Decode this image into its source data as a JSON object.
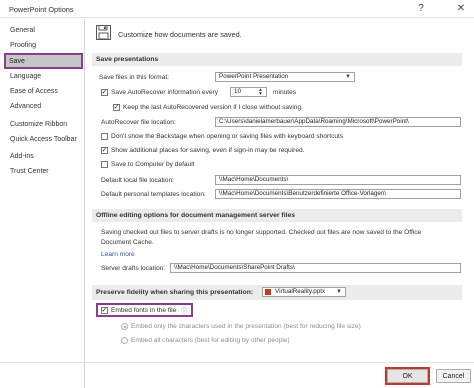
{
  "window": {
    "title": "PowerPoint Options",
    "help_icon": "?",
    "close_icon": "✕"
  },
  "sidebar": {
    "items": [
      {
        "label": "General"
      },
      {
        "label": "Proofing"
      },
      {
        "label": "Save"
      },
      {
        "label": "Language"
      },
      {
        "label": "Ease of Access"
      },
      {
        "label": "Advanced"
      },
      {
        "label": "Customize Ribbon"
      },
      {
        "label": "Quick Access Toolbar"
      },
      {
        "label": "Add-ins"
      },
      {
        "label": "Trust Center"
      }
    ]
  },
  "header": {
    "text": "Customize how documents are saved.",
    "icon": "save-floppy-icon"
  },
  "save_presentations": {
    "title": "Save presentations",
    "format_label": "Save files in this format:",
    "format_value": "PowerPoint Presentation",
    "autorecover_label": "Save AutoRecover information every",
    "autorecover_checked": true,
    "minutes_value": "10",
    "minutes_label": "minutes",
    "keep_last_label": "Keep the last AutoRecovered version if I close without saving",
    "keep_last_checked": true,
    "autorecover_location_label": "AutoRecover file location:",
    "autorecover_location_value": "C:\\Users\\danielamerbauer\\AppData\\Roaming\\Microsoft\\PowerPoint\\",
    "backstage_label": "Don't show the Backstage when opening or saving files with keyboard shortcuts",
    "backstage_checked": false,
    "additional_places_label": "Show additional places for saving, even if sign-in may be required.",
    "additional_places_checked": true,
    "save_computer_label": "Save to Computer by default",
    "save_computer_checked": false,
    "default_local_label": "Default local file location:",
    "default_local_value": "\\\\Mac\\Home\\Documents\\",
    "templates_label": "Default personal templates location:",
    "templates_value": "\\\\Mac\\Home\\Documents\\Benutzerdefinierte Office-Vorlagen\\"
  },
  "offline": {
    "title": "Offline editing options for document management server files",
    "description_line1": "Saving checked out files to server drafts is no longer supported. Checked out files are now saved to the Office",
    "description_line2": "Document Cache.",
    "learn_more": "Learn more",
    "drafts_label": "Server drafts location:",
    "drafts_value": "\\\\Mac\\Home\\Documents\\SharePoint Drafts\\"
  },
  "fidelity": {
    "title": "Preserve fidelity when sharing this presentation:",
    "file_value": "VirtualReality.pptx",
    "embed_label": "Embed fonts in the file",
    "embed_checked": true,
    "radio_used_label": "Embed only the characters used in the presentation (best for reducing file size)",
    "radio_all_label": "Embed all characters (best for editing by other people)",
    "radio_selected": "used"
  },
  "footer": {
    "ok_label": "OK",
    "cancel_label": "Cancel"
  },
  "colors": {
    "highlight": "#8a3c8f",
    "ok_outline": "#c0392b",
    "section_bg": "#ebebeb"
  }
}
